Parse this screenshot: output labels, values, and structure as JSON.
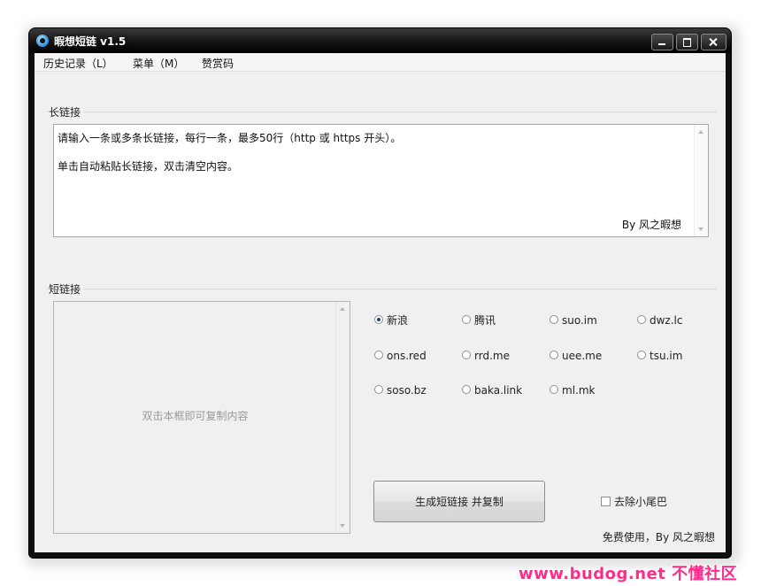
{
  "window": {
    "title": "暇想短链 v1.5"
  },
  "menu": {
    "items": [
      {
        "label": "历史记录（L）"
      },
      {
        "label": "菜单（M）"
      },
      {
        "label": "赞赏码"
      }
    ]
  },
  "long_link": {
    "group_label": "长链接",
    "line1": "请输入一条或多条长链接，每行一条，最多50行（http 或 https 开头）。",
    "line2": "单击自动粘贴长链接，双击清空内容。",
    "author": "By 风之暇想"
  },
  "short_link": {
    "group_label": "短链接",
    "placeholder": "双击本框即可复制内容"
  },
  "services": [
    {
      "label": "新浪",
      "checked": true
    },
    {
      "label": "腾讯",
      "checked": false
    },
    {
      "label": "suo.im",
      "checked": false
    },
    {
      "label": "dwz.lc",
      "checked": false
    },
    {
      "label": "ons.red",
      "checked": false
    },
    {
      "label": "rrd.me",
      "checked": false
    },
    {
      "label": "uee.me",
      "checked": false
    },
    {
      "label": "tsu.im",
      "checked": false
    },
    {
      "label": "soso.bz",
      "checked": false
    },
    {
      "label": "baka.link",
      "checked": false
    },
    {
      "label": "ml.mk",
      "checked": false
    }
  ],
  "actions": {
    "generate_label": "生成短链接 并复制",
    "remove_tail_label": "去除小尾巴",
    "remove_tail_checked": false
  },
  "status": {
    "text": "免费使用，By 风之暇想"
  },
  "watermark": {
    "text": "www.budog.net 不懂社区"
  }
}
